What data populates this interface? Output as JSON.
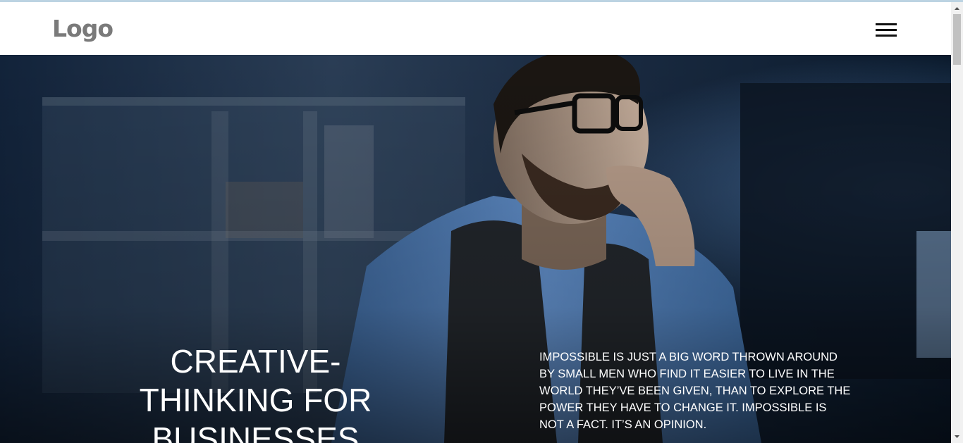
{
  "header": {
    "logo_text": "Logo",
    "menu_icon": "hamburger-menu-icon"
  },
  "hero": {
    "background": "photo of a bearded man in glasses and a blue shirt looking at a monitor in a dark office",
    "title": "CREATIVE-THINKING FOR BUSINESSES",
    "quote": "IMPOSSIBLE IS JUST A BIG WORD THROWN AROUND BY SMALL MEN WHO FIND IT EASIER TO LIVE IN THE WORLD THEY’VE BEEN GIVEN, THAN TO EXPLORE THE POWER THEY HAVE TO CHANGE IT. IMPOSSIBLE IS NOT A FACT. IT’S AN OPINION."
  },
  "colors": {
    "header_bg": "#ffffff",
    "logo": "#7a7a7a",
    "menu_icon": "#111111",
    "hero_text": "#ffffff",
    "top_strip": "#bcd3e2"
  }
}
